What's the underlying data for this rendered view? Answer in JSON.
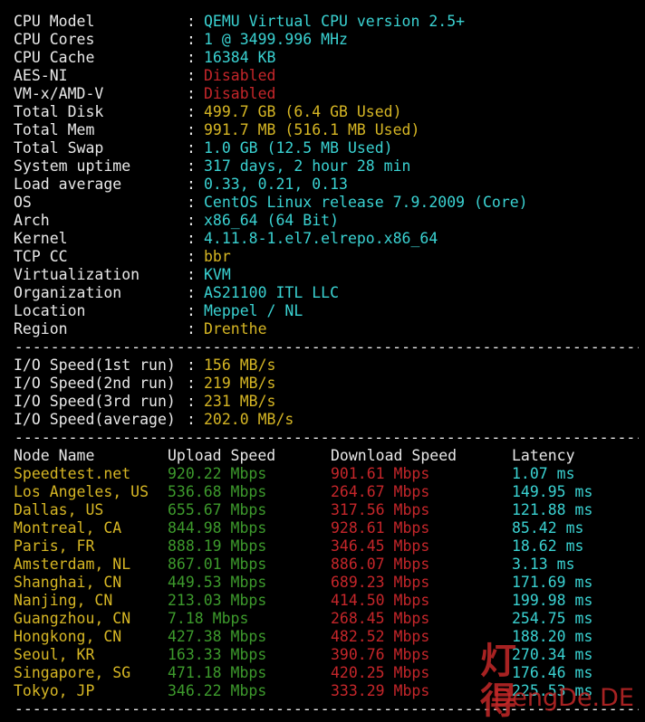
{
  "system_info": [
    {
      "key": "CPU Model",
      "value": "QEMU Virtual CPU version 2.5+",
      "color": "cyan"
    },
    {
      "key": "CPU Cores",
      "value": "1 @ 3499.996 MHz",
      "color": "cyan"
    },
    {
      "key": "CPU Cache",
      "value": "16384 KB",
      "color": "cyan"
    },
    {
      "key": "AES-NI",
      "value": "Disabled",
      "color": "red"
    },
    {
      "key": "VM-x/AMD-V",
      "value": "Disabled",
      "color": "red"
    },
    {
      "key": "Total Disk",
      "value": "499.7 GB (6.4 GB Used)",
      "color": "yellow"
    },
    {
      "key": "Total Mem",
      "value": "991.7 MB (516.1 MB Used)",
      "color": "yellow"
    },
    {
      "key": "Total Swap",
      "value": "1.0 GB (12.5 MB Used)",
      "color": "cyan"
    },
    {
      "key": "System uptime",
      "value": "317 days, 2 hour 28 min",
      "color": "cyan"
    },
    {
      "key": "Load average",
      "value": "0.33, 0.21, 0.13",
      "color": "cyan"
    },
    {
      "key": "OS",
      "value": "CentOS Linux release 7.9.2009 (Core)",
      "color": "cyan"
    },
    {
      "key": "Arch",
      "value": "x86_64 (64 Bit)",
      "color": "cyan"
    },
    {
      "key": "Kernel",
      "value": "4.11.8-1.el7.elrepo.x86_64",
      "color": "cyan"
    },
    {
      "key": "TCP CC",
      "value": "bbr",
      "color": "yellow"
    },
    {
      "key": "Virtualization",
      "value": "KVM",
      "color": "cyan"
    },
    {
      "key": "Organization",
      "value": "AS21100 ITL LLC",
      "color": "cyan"
    },
    {
      "key": "Location",
      "value": "Meppel / NL",
      "color": "cyan"
    },
    {
      "key": "Region",
      "value": "Drenthe",
      "color": "yellow"
    }
  ],
  "separator_colon": ":",
  "separator_line": "------------------------------------------------------------------------------",
  "io_speed": [
    {
      "key": "I/O Speed(1st run)",
      "value": "156 MB/s"
    },
    {
      "key": "I/O Speed(2nd run)",
      "value": "219 MB/s"
    },
    {
      "key": "I/O Speed(3rd run)",
      "value": "231 MB/s"
    },
    {
      "key": "I/O Speed(average)",
      "value": "202.0 MB/s"
    }
  ],
  "speedtest": {
    "headers": {
      "node": "Node Name",
      "upload": "Upload Speed",
      "download": "Download Speed",
      "latency": "Latency"
    },
    "rows": [
      {
        "node": "Speedtest.net",
        "upload": "920.22 Mbps",
        "download": "901.61 Mbps",
        "latency": "1.07 ms"
      },
      {
        "node": "Los Angeles, US",
        "upload": "536.68 Mbps",
        "download": "264.67 Mbps",
        "latency": "149.95 ms"
      },
      {
        "node": "Dallas, US",
        "upload": "655.67 Mbps",
        "download": "317.56 Mbps",
        "latency": "121.88 ms"
      },
      {
        "node": "Montreal, CA",
        "upload": "844.98 Mbps",
        "download": "928.61 Mbps",
        "latency": "85.42 ms"
      },
      {
        "node": "Paris, FR",
        "upload": "888.19 Mbps",
        "download": "346.45 Mbps",
        "latency": "18.62 ms"
      },
      {
        "node": "Amsterdam, NL",
        "upload": "867.01 Mbps",
        "download": "886.07 Mbps",
        "latency": "3.13 ms"
      },
      {
        "node": "Shanghai, CN",
        "upload": "449.53 Mbps",
        "download": "689.23 Mbps",
        "latency": "171.69 ms"
      },
      {
        "node": "Nanjing, CN",
        "upload": "213.03 Mbps",
        "download": "414.50 Mbps",
        "latency": "199.98 ms"
      },
      {
        "node": "Guangzhou, CN",
        "upload": "7.18 Mbps",
        "download": "268.45 Mbps",
        "latency": "254.75 ms"
      },
      {
        "node": "Hongkong, CN",
        "upload": "427.38 Mbps",
        "download": "482.52 Mbps",
        "latency": "188.20 ms"
      },
      {
        "node": "Seoul, KR",
        "upload": "163.33 Mbps",
        "download": "390.76 Mbps",
        "latency": "270.34 ms"
      },
      {
        "node": "Singapore, SG",
        "upload": "471.18 Mbps",
        "download": "420.25 Mbps",
        "latency": "176.46 ms"
      },
      {
        "node": "Tokyo, JP",
        "upload": "346.22 Mbps",
        "download": "333.29 Mbps",
        "latency": "225.53 ms"
      }
    ]
  },
  "watermark": {
    "chinese": "灯得",
    "english": "DengDe.DE"
  },
  "colors": {
    "background": "#000000",
    "label": "#e8e8e8",
    "cyan": "#3ad2d2",
    "yellow": "#d6b624",
    "red": "#c5262a",
    "green": "#3d9a2c",
    "watermark": "#c42828"
  }
}
